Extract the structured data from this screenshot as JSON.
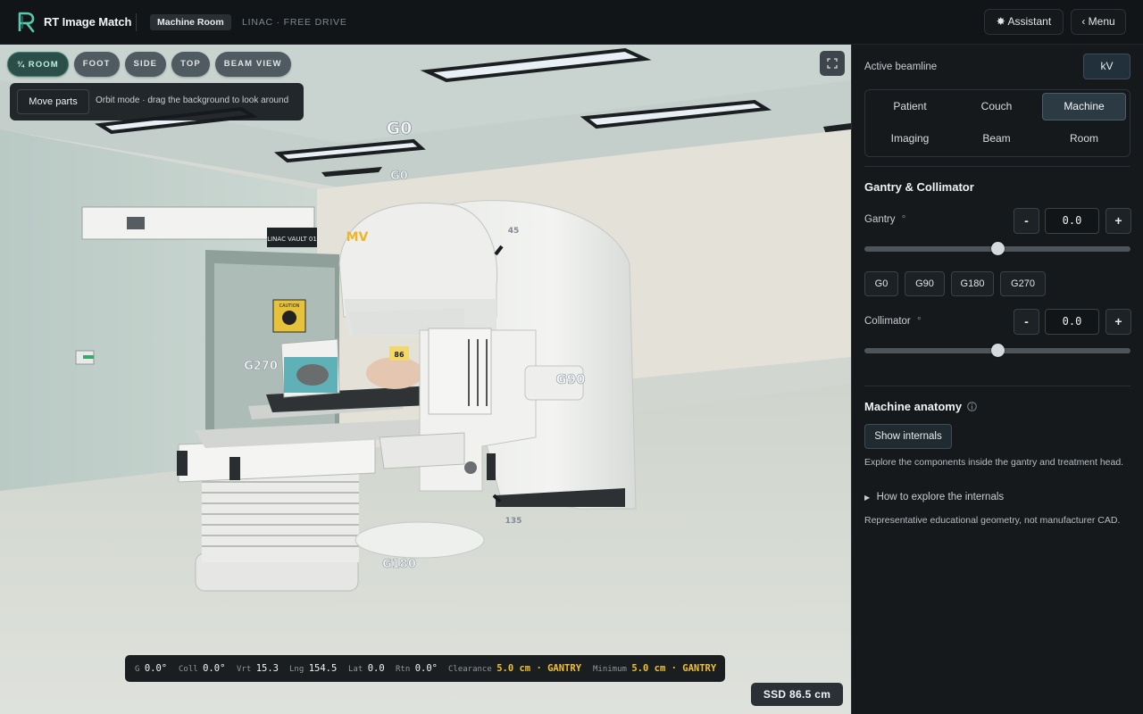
{
  "app": {
    "title": "RT Image Match",
    "section": "Machine Room",
    "mode": "LINAC · FREE DRIVE",
    "assistant_label": "✸ Assistant",
    "menu_label": "‹ Menu"
  },
  "viewport": {
    "views": [
      {
        "label": "¾ ROOM",
        "active": true
      },
      {
        "label": "FOOT",
        "active": false
      },
      {
        "label": "SIDE",
        "active": false
      },
      {
        "label": "TOP",
        "active": false
      },
      {
        "label": "BEAM VIEW",
        "active": false
      }
    ],
    "move_parts_label": "Move parts",
    "hint": "Orbit mode · drag the background to look around",
    "scene_labels": {
      "g0_top": "G0",
      "g0": "G0",
      "g90": "G90",
      "g180": "G180",
      "g270": "G270",
      "mv": "MV",
      "deg45": "45",
      "deg135": "135",
      "marker86": "86",
      "sign": "LINAC VAULT 01",
      "caution": "CAUTION"
    },
    "status": {
      "g_label": "G",
      "g_value": "0.0°",
      "coll_label": "Coll",
      "coll_value": "0.0°",
      "vrt_label": "Vrt",
      "vrt_value": "15.3",
      "lng_label": "Lng",
      "lng_value": "154.5",
      "lat_label": "Lat",
      "lat_value": "0.0",
      "rtn_label": "Rtn",
      "rtn_value": "0.0°",
      "clearance_label": "Clearance",
      "clearance_value": "5.0 cm · GANTRY",
      "minimum_label": "Minimum",
      "minimum_value": "5.0 cm · GANTRY"
    },
    "ssd": "SSD 86.5 cm"
  },
  "panel": {
    "active_beamline_label": "Active beamline",
    "beamline_value": "kV",
    "tabs": [
      {
        "label": "Patient",
        "active": false
      },
      {
        "label": "Couch",
        "active": false
      },
      {
        "label": "Machine",
        "active": true
      },
      {
        "label": "Imaging",
        "active": false
      },
      {
        "label": "Beam",
        "active": false
      },
      {
        "label": "Room",
        "active": false
      }
    ],
    "gantry_section_title": "Gantry & Collimator",
    "gantry": {
      "label": "Gantry",
      "unit": "°",
      "value": "0.0",
      "slider_fraction": 0.5
    },
    "presets": [
      "G0",
      "G90",
      "G180",
      "G270"
    ],
    "collimator": {
      "label": "Collimator",
      "unit": "°",
      "value": "0.0",
      "slider_fraction": 0.5
    },
    "minus": "-",
    "plus": "+",
    "anatomy_title": "Machine anatomy",
    "show_internals_label": "Show internals",
    "anatomy_desc": "Explore the components inside the gantry and treatment head.",
    "how_to_label": "How to explore the internals",
    "disclaimer": "Representative educational geometry, not manufacturer CAD."
  },
  "colors": {
    "accent_green": "#2b4f48",
    "warning": "#f0c030",
    "panel_bg": "#16191c"
  }
}
